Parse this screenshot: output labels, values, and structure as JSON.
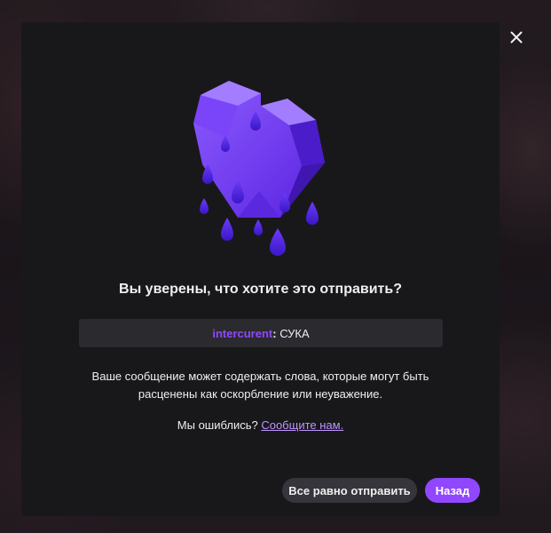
{
  "dialog": {
    "title": "Вы уверены, что хотите это отправить?",
    "message": {
      "username": "intercurent",
      "separator": ":",
      "text": " СУКА"
    },
    "warning": "Ваше сообщение может содержать слова, которые могут быть расценены как оскорбление или неуважение.",
    "mistake_prompt": "Мы ошиблись? ",
    "report_link": "Сообщите нам.",
    "send_anyway_label": "Все равно отправить",
    "back_label": "Назад",
    "illustration": "crying-heart-icon",
    "close_icon": "close-icon"
  },
  "colors": {
    "accent": "#9147ff",
    "link": "#bf94ff",
    "modal_bg": "#18181b",
    "message_bg": "#2a2a2f"
  }
}
